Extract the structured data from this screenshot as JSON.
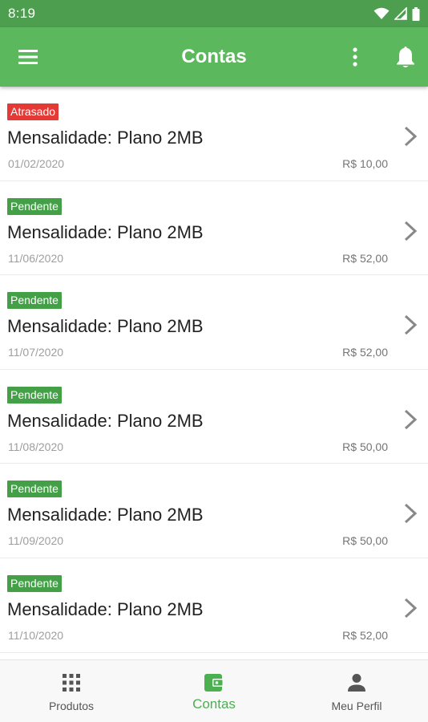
{
  "status_bar": {
    "time": "8:19"
  },
  "app_bar": {
    "title": "Contas"
  },
  "colors": {
    "primary": "#5cb85c",
    "status_bar": "#4d9e4f",
    "badge_overdue": "#e53935",
    "badge_pending": "#43a047",
    "nav_active": "#4caf50"
  },
  "bills": [
    {
      "status": "Atrasado",
      "status_type": "overdue",
      "title": "Mensalidade: Plano 2MB",
      "date": "01/02/2020",
      "amount": "R$ 10,00"
    },
    {
      "status": "Pendente",
      "status_type": "pending",
      "title": "Mensalidade: Plano 2MB",
      "date": "11/06/2020",
      "amount": "R$ 52,00"
    },
    {
      "status": "Pendente",
      "status_type": "pending",
      "title": "Mensalidade: Plano 2MB",
      "date": "11/07/2020",
      "amount": "R$ 52,00"
    },
    {
      "status": "Pendente",
      "status_type": "pending",
      "title": "Mensalidade: Plano 2MB",
      "date": "11/08/2020",
      "amount": "R$ 50,00"
    },
    {
      "status": "Pendente",
      "status_type": "pending",
      "title": "Mensalidade: Plano 2MB",
      "date": "11/09/2020",
      "amount": "R$ 50,00"
    },
    {
      "status": "Pendente",
      "status_type": "pending",
      "title": "Mensalidade: Plano 2MB",
      "date": "11/10/2020",
      "amount": "R$ 52,00"
    }
  ],
  "bottom_nav": {
    "items": [
      {
        "label": "Produtos",
        "icon": "grid-icon",
        "active": false
      },
      {
        "label": "Contas",
        "icon": "wallet-icon",
        "active": true
      },
      {
        "label": "Meu Perfil",
        "icon": "person-icon",
        "active": false
      }
    ]
  }
}
